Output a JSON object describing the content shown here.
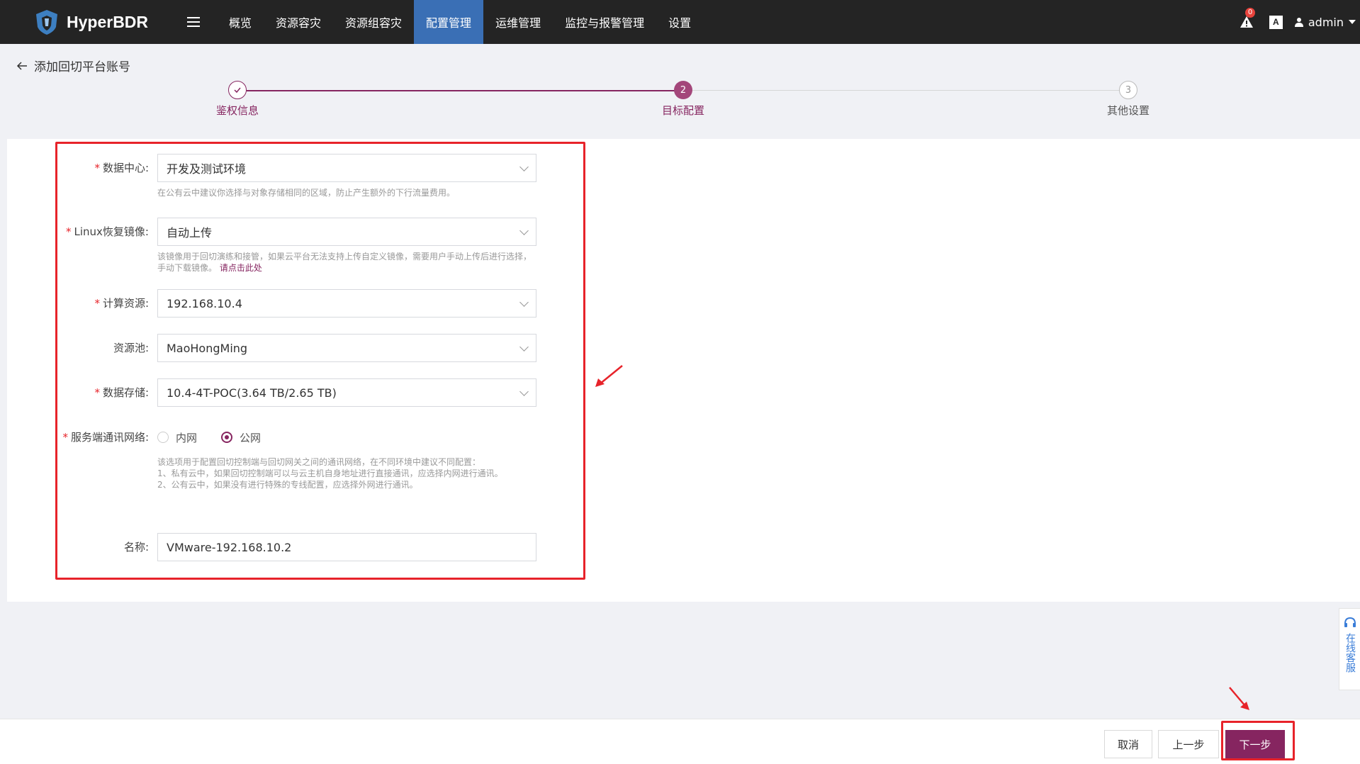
{
  "brand": {
    "name": "HyperBDR"
  },
  "nav": {
    "items": [
      "概览",
      "资源容灾",
      "资源组容灾",
      "配置管理",
      "运维管理",
      "监控与报警管理",
      "设置"
    ],
    "active_index": 3
  },
  "topbar": {
    "alert_count": "0",
    "language_icon": "A",
    "user": "admin"
  },
  "page": {
    "title": "添加回切平台账号"
  },
  "steps": [
    {
      "label": "鉴权信息",
      "state": "done",
      "number": "1"
    },
    {
      "label": "目标配置",
      "state": "current",
      "number": "2"
    },
    {
      "label": "其他设置",
      "state": "pending",
      "number": "3"
    }
  ],
  "form": {
    "datacenter": {
      "label": "数据中心:",
      "value": "开发及测试环境",
      "hint": "在公有云中建议你选择与对象存储相同的区域，防止产生额外的下行流量费用。"
    },
    "linux_image": {
      "label": "Linux恢复镜像:",
      "value": "自动上传",
      "hint": "该镜像用于回切演练和接管，如果云平台无法支持上传自定义镜像，需要用户手动上传后进行选择，手动下载镜像。",
      "link": "请点击此处"
    },
    "compute": {
      "label": "计算资源:",
      "value": "192.168.10.4"
    },
    "pool": {
      "label": "资源池:",
      "value": "MaoHongMing"
    },
    "storage": {
      "label": "数据存储:",
      "value": "10.4-4T-POC(3.64 TB/2.65 TB)"
    },
    "network": {
      "label": "服务端通讯网络:",
      "options": [
        "内网",
        "公网"
      ],
      "selected": "公网",
      "hint_lines": [
        "该选项用于配置回切控制端与回切网关之间的通讯网络，在不同环境中建议不同配置：",
        "1、私有云中，如果回切控制端可以与云主机自身地址进行直接通讯，应选择内网进行通讯。",
        "2、公有云中，如果没有进行特殊的专线配置，应选择外网进行通讯。"
      ]
    },
    "name": {
      "label": "名称:",
      "value": "VMware-192.168.10.2"
    }
  },
  "service": {
    "label": "在线客服"
  },
  "footer": {
    "cancel": "取消",
    "prev": "上一步",
    "next": "下一步"
  },
  "colors": {
    "topbar": "#242424",
    "nav_active": "#3a6fb5",
    "accent": "#862560",
    "annotation": "#e7232a"
  }
}
